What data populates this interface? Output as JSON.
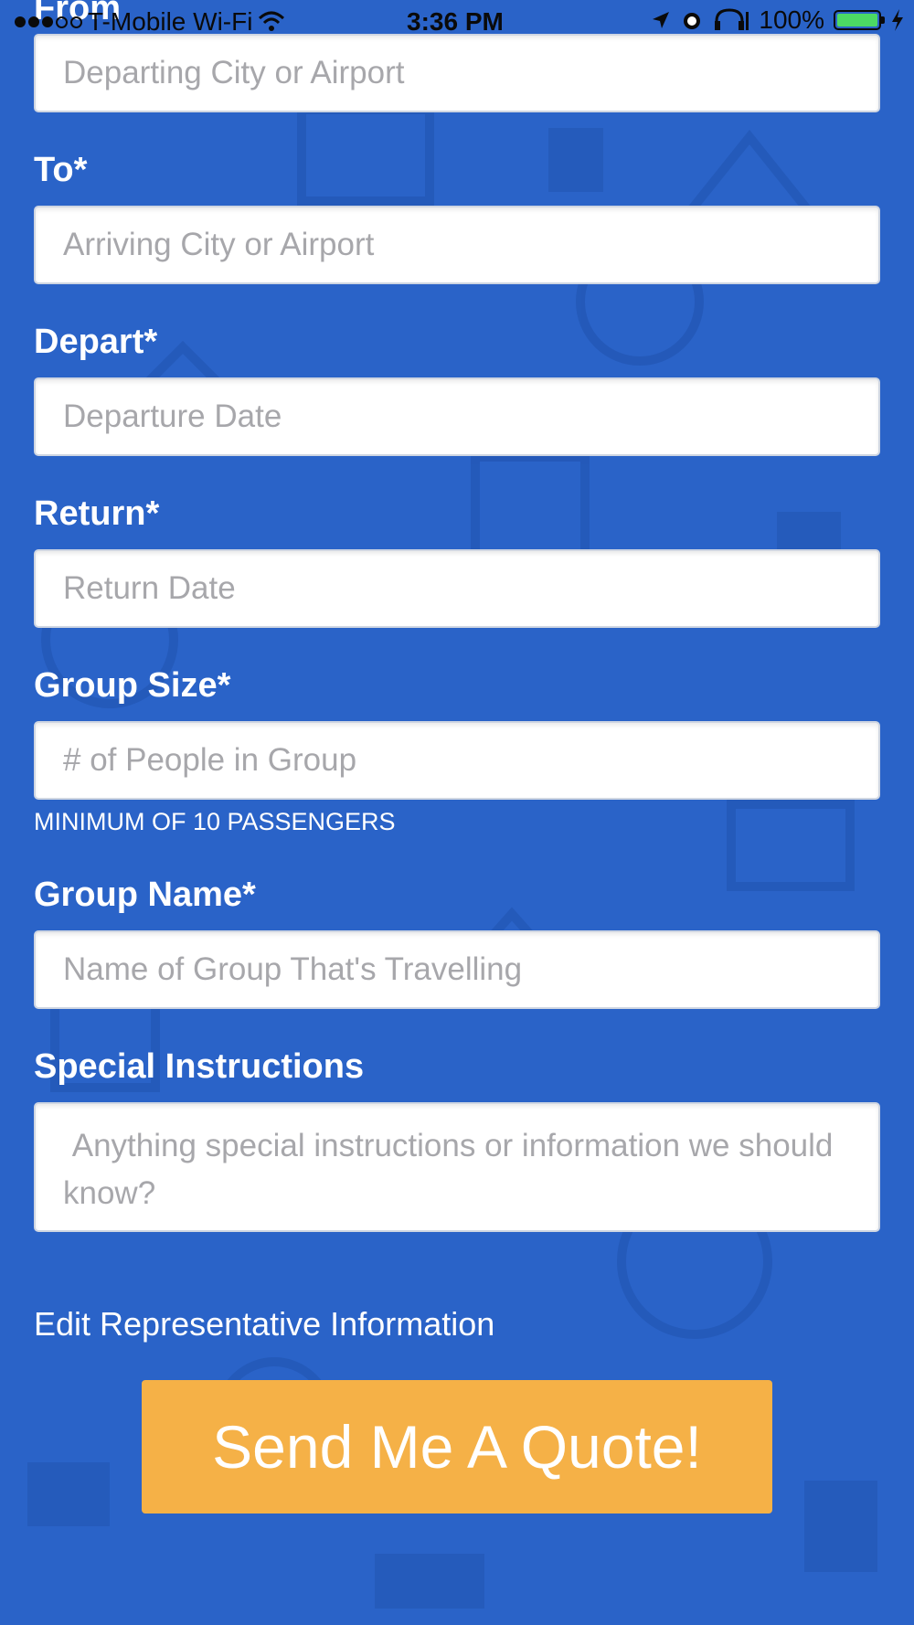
{
  "status_bar": {
    "carrier": "T-Mobile Wi-Fi",
    "time": "3:36 PM",
    "battery": "100%"
  },
  "form": {
    "from": {
      "label": "From",
      "placeholder": "Departing City or Airport"
    },
    "to": {
      "label": "To*",
      "placeholder": "Arriving City or Airport"
    },
    "depart": {
      "label": "Depart*",
      "placeholder": "Departure Date"
    },
    "return": {
      "label": "Return*",
      "placeholder": "Return Date"
    },
    "group_size": {
      "label": "Group Size*",
      "placeholder": "# of People in Group",
      "hint": "MINIMUM OF 10 PASSENGERS"
    },
    "group_name": {
      "label": "Group Name*",
      "placeholder": "Name of Group That's Travelling"
    },
    "special_instructions": {
      "label": "Special Instructions",
      "placeholder": " Anything special instructions or information we should know?"
    }
  },
  "edit_rep_link": "Edit Representative Information",
  "submit_label": "Send Me A Quote!",
  "colors": {
    "background": "#2a63c8",
    "button": "#f5b147",
    "battery": "#4cd964"
  },
  "icons": [
    "wifi-icon",
    "location-arrow-icon",
    "alarm-icon",
    "headphones-icon",
    "battery-icon",
    "charging-icon"
  ]
}
